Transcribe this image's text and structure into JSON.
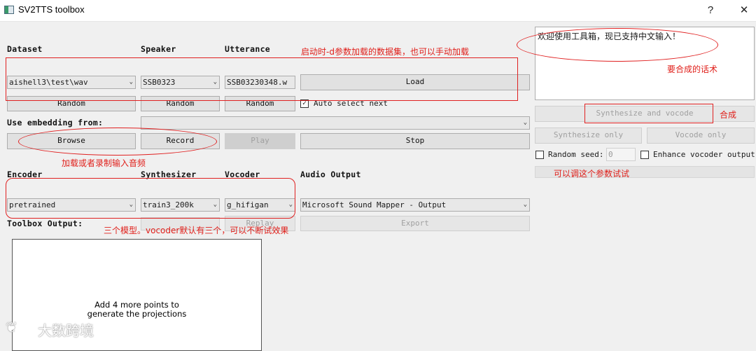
{
  "window": {
    "title": "SV2TTS toolbox",
    "help_btn": "?",
    "close_btn": "✕"
  },
  "labels": {
    "dataset": "Dataset",
    "speaker": "Speaker",
    "utterance": "Utterance",
    "use_embedding": "Use embedding from:",
    "encoder": "Encoder",
    "synthesizer": "Synthesizer",
    "vocoder": "Vocoder",
    "audio_output": "Audio Output",
    "toolbox_output": "Toolbox Output:"
  },
  "combos": {
    "dataset": "aishell3\\test\\wav",
    "speaker": "SSB0323",
    "utterance": "SSB03230348.w",
    "embedding": "",
    "encoder": "pretrained",
    "synthesizer": "train3_200k",
    "vocoder": "g_hifigan",
    "audio_output": "Microsoft Sound Mapper - Output"
  },
  "buttons": {
    "load": "Load",
    "random": "Random",
    "browse": "Browse",
    "record": "Record",
    "play": "Play",
    "stop": "Stop",
    "replay": "Replay",
    "export": "Export",
    "synth_vocode": "Synthesize and vocode",
    "synth_only": "Synthesize only",
    "vocode_only": "Vocode only"
  },
  "checks": {
    "auto_select_next": "Auto select next",
    "random_seed": "Random seed:",
    "random_seed_value": "0",
    "enhance_vocoder": "Enhance vocoder output"
  },
  "text_input": "欢迎使用工具箱，现已支持中文输入！",
  "plot_message": [
    "Add 4 more points to",
    "generate the projections"
  ],
  "annotations": {
    "load_note": "启动时-d参数加载的数据集，也可以手动加载",
    "text_note": "要合成的话术",
    "synth_note": "合成",
    "browse_note": "加载或者录制输入音频",
    "seed_note": "可以调这个参数试试",
    "model_note": "三个模型。vocoder默认有三个，可以不断试效果"
  },
  "watermark": "大数跨境",
  "colors": {
    "annotation": "#e02020",
    "background": "#f0f0f0"
  }
}
